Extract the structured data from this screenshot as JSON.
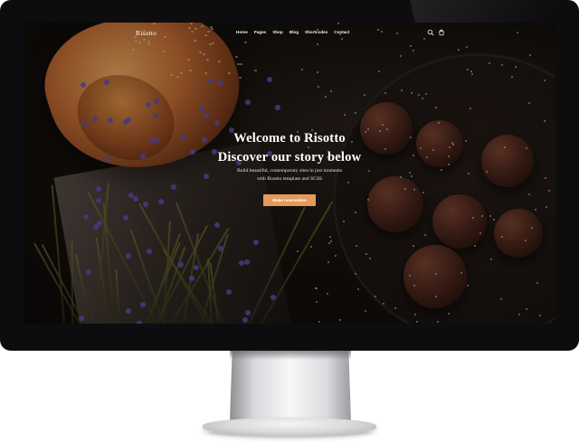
{
  "site": {
    "logo": "Risotto",
    "nav": [
      "Home",
      "Pages",
      "Shop",
      "Blog",
      "Shortcodes",
      "Contact"
    ],
    "icons": [
      "search-icon",
      "cart-icon"
    ]
  },
  "hero": {
    "title_line1": "Welcome to Risotto",
    "title_line2": "Discover our story below",
    "subtitle_line1": "Build beautiful, contemporary sites in just moments",
    "subtitle_line2": "with Risotto template and SCSS",
    "cta_label": "Make reservation"
  },
  "colors": {
    "accent": "#e39a5a",
    "bezel": "#0d0d0f",
    "text": "#ffffff"
  }
}
